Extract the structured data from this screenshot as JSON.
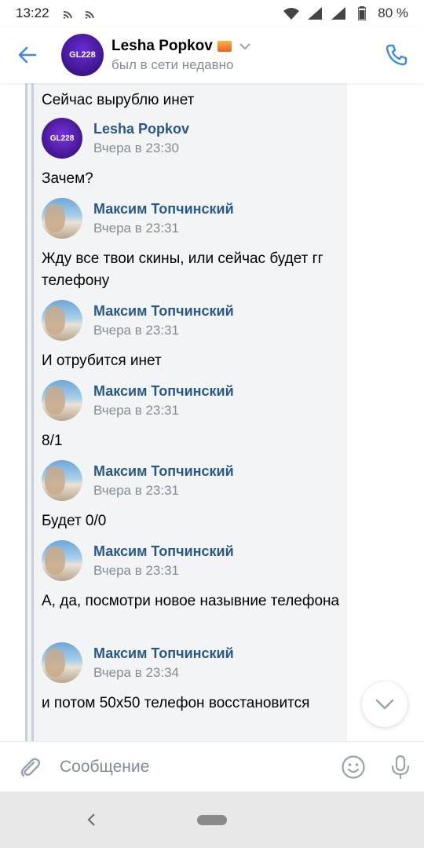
{
  "status_bar": {
    "time": "13:22",
    "battery": "80 %"
  },
  "header": {
    "name": "Lesha Popkov",
    "status": "был в сети недавно",
    "avatar_text": "GL228"
  },
  "messages": [
    {
      "kind": "text",
      "text": "Сейчас вырублю инет"
    },
    {
      "kind": "head",
      "author": "Lesha Popkov",
      "time": "Вчера в 23:30",
      "avatar": "lesha"
    },
    {
      "kind": "text",
      "text": "Зачем?"
    },
    {
      "kind": "head",
      "author": "Максим Топчинский",
      "time": "Вчера в 23:31",
      "avatar": "maxim"
    },
    {
      "kind": "text",
      "text": "Жду все твои скины, или сейчас будет гг телефону"
    },
    {
      "kind": "head",
      "author": "Максим Топчинский",
      "time": "Вчера в 23:31",
      "avatar": "maxim"
    },
    {
      "kind": "text",
      "text": "И отрубится инет"
    },
    {
      "kind": "head",
      "author": "Максим Топчинский",
      "time": "Вчера в 23:31",
      "avatar": "maxim"
    },
    {
      "kind": "text",
      "text": "8/1"
    },
    {
      "kind": "head",
      "author": "Максим Топчинский",
      "time": "Вчера в 23:31",
      "avatar": "maxim"
    },
    {
      "kind": "text",
      "text": "Будет 0/0"
    },
    {
      "kind": "head",
      "author": "Максим Топчинский",
      "time": "Вчера в 23:31",
      "avatar": "maxim"
    },
    {
      "kind": "text",
      "text": "А, да, посмотри новое назывние телефона"
    },
    {
      "kind": "head",
      "author": "Максим Топчинский",
      "time": "Вчера в 23:34",
      "avatar": "maxim"
    },
    {
      "kind": "text",
      "text": "и потом 50х50 телефон восстановится"
    }
  ],
  "composer": {
    "placeholder": "Сообщение"
  },
  "colors": {
    "accent": "#3f8ae0",
    "author_name": "#2a5885",
    "secondary_text": "#818c99"
  },
  "icons": {
    "back": "arrow-left-icon",
    "call": "phone-icon",
    "attach": "paperclip-icon",
    "emoji": "smile-icon",
    "mic": "microphone-icon",
    "scroll": "chevron-down-icon"
  }
}
